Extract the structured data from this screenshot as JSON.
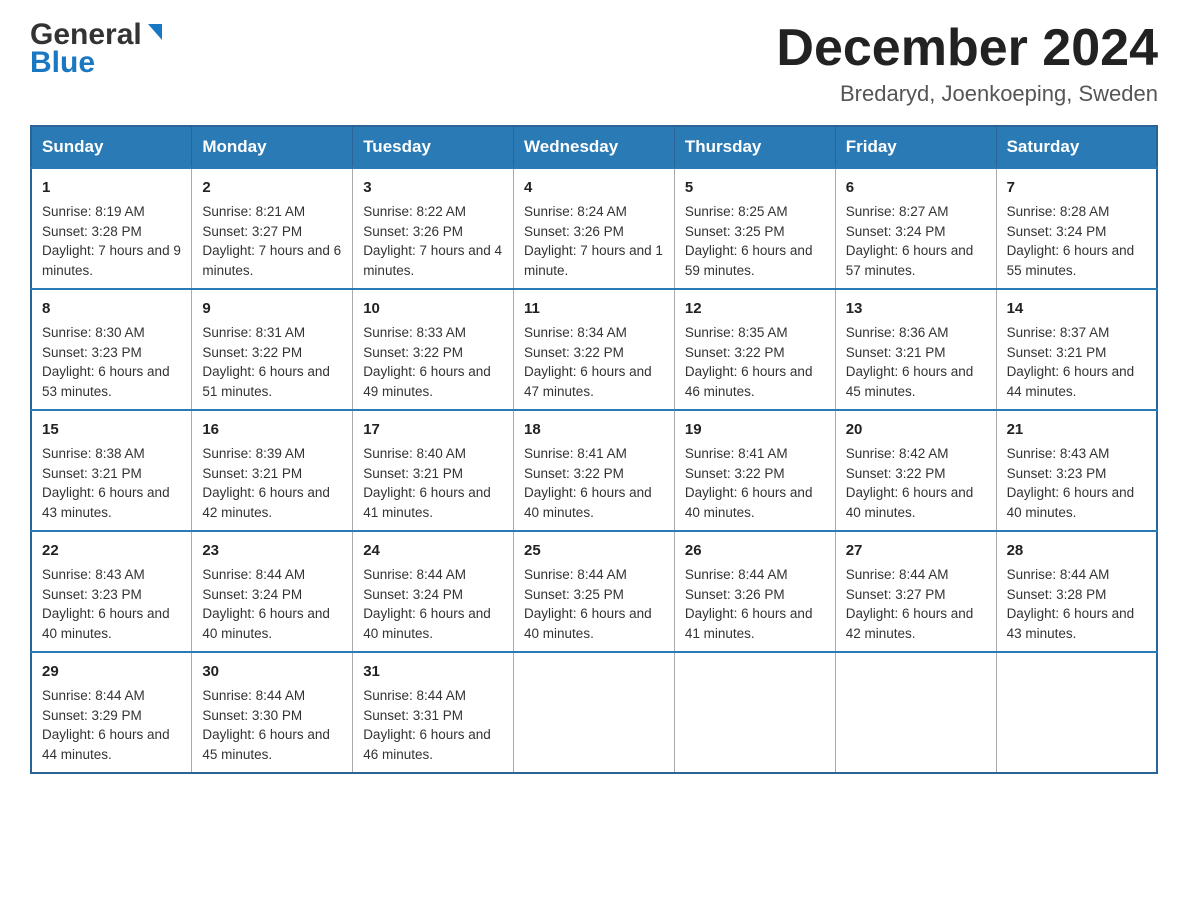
{
  "header": {
    "logo_general": "General",
    "logo_blue": "Blue",
    "month_title": "December 2024",
    "location": "Bredaryd, Joenkoeping, Sweden"
  },
  "columns": [
    "Sunday",
    "Monday",
    "Tuesday",
    "Wednesday",
    "Thursday",
    "Friday",
    "Saturday"
  ],
  "weeks": [
    [
      {
        "day": "1",
        "sunrise": "8:19 AM",
        "sunset": "3:28 PM",
        "daylight": "7 hours and 9 minutes."
      },
      {
        "day": "2",
        "sunrise": "8:21 AM",
        "sunset": "3:27 PM",
        "daylight": "7 hours and 6 minutes."
      },
      {
        "day": "3",
        "sunrise": "8:22 AM",
        "sunset": "3:26 PM",
        "daylight": "7 hours and 4 minutes."
      },
      {
        "day": "4",
        "sunrise": "8:24 AM",
        "sunset": "3:26 PM",
        "daylight": "7 hours and 1 minute."
      },
      {
        "day": "5",
        "sunrise": "8:25 AM",
        "sunset": "3:25 PM",
        "daylight": "6 hours and 59 minutes."
      },
      {
        "day": "6",
        "sunrise": "8:27 AM",
        "sunset": "3:24 PM",
        "daylight": "6 hours and 57 minutes."
      },
      {
        "day": "7",
        "sunrise": "8:28 AM",
        "sunset": "3:24 PM",
        "daylight": "6 hours and 55 minutes."
      }
    ],
    [
      {
        "day": "8",
        "sunrise": "8:30 AM",
        "sunset": "3:23 PM",
        "daylight": "6 hours and 53 minutes."
      },
      {
        "day": "9",
        "sunrise": "8:31 AM",
        "sunset": "3:22 PM",
        "daylight": "6 hours and 51 minutes."
      },
      {
        "day": "10",
        "sunrise": "8:33 AM",
        "sunset": "3:22 PM",
        "daylight": "6 hours and 49 minutes."
      },
      {
        "day": "11",
        "sunrise": "8:34 AM",
        "sunset": "3:22 PM",
        "daylight": "6 hours and 47 minutes."
      },
      {
        "day": "12",
        "sunrise": "8:35 AM",
        "sunset": "3:22 PM",
        "daylight": "6 hours and 46 minutes."
      },
      {
        "day": "13",
        "sunrise": "8:36 AM",
        "sunset": "3:21 PM",
        "daylight": "6 hours and 45 minutes."
      },
      {
        "day": "14",
        "sunrise": "8:37 AM",
        "sunset": "3:21 PM",
        "daylight": "6 hours and 44 minutes."
      }
    ],
    [
      {
        "day": "15",
        "sunrise": "8:38 AM",
        "sunset": "3:21 PM",
        "daylight": "6 hours and 43 minutes."
      },
      {
        "day": "16",
        "sunrise": "8:39 AM",
        "sunset": "3:21 PM",
        "daylight": "6 hours and 42 minutes."
      },
      {
        "day": "17",
        "sunrise": "8:40 AM",
        "sunset": "3:21 PM",
        "daylight": "6 hours and 41 minutes."
      },
      {
        "day": "18",
        "sunrise": "8:41 AM",
        "sunset": "3:22 PM",
        "daylight": "6 hours and 40 minutes."
      },
      {
        "day": "19",
        "sunrise": "8:41 AM",
        "sunset": "3:22 PM",
        "daylight": "6 hours and 40 minutes."
      },
      {
        "day": "20",
        "sunrise": "8:42 AM",
        "sunset": "3:22 PM",
        "daylight": "6 hours and 40 minutes."
      },
      {
        "day": "21",
        "sunrise": "8:43 AM",
        "sunset": "3:23 PM",
        "daylight": "6 hours and 40 minutes."
      }
    ],
    [
      {
        "day": "22",
        "sunrise": "8:43 AM",
        "sunset": "3:23 PM",
        "daylight": "6 hours and 40 minutes."
      },
      {
        "day": "23",
        "sunrise": "8:44 AM",
        "sunset": "3:24 PM",
        "daylight": "6 hours and 40 minutes."
      },
      {
        "day": "24",
        "sunrise": "8:44 AM",
        "sunset": "3:24 PM",
        "daylight": "6 hours and 40 minutes."
      },
      {
        "day": "25",
        "sunrise": "8:44 AM",
        "sunset": "3:25 PM",
        "daylight": "6 hours and 40 minutes."
      },
      {
        "day": "26",
        "sunrise": "8:44 AM",
        "sunset": "3:26 PM",
        "daylight": "6 hours and 41 minutes."
      },
      {
        "day": "27",
        "sunrise": "8:44 AM",
        "sunset": "3:27 PM",
        "daylight": "6 hours and 42 minutes."
      },
      {
        "day": "28",
        "sunrise": "8:44 AM",
        "sunset": "3:28 PM",
        "daylight": "6 hours and 43 minutes."
      }
    ],
    [
      {
        "day": "29",
        "sunrise": "8:44 AM",
        "sunset": "3:29 PM",
        "daylight": "6 hours and 44 minutes."
      },
      {
        "day": "30",
        "sunrise": "8:44 AM",
        "sunset": "3:30 PM",
        "daylight": "6 hours and 45 minutes."
      },
      {
        "day": "31",
        "sunrise": "8:44 AM",
        "sunset": "3:31 PM",
        "daylight": "6 hours and 46 minutes."
      },
      null,
      null,
      null,
      null
    ]
  ],
  "labels": {
    "sunrise": "Sunrise:",
    "sunset": "Sunset:",
    "daylight": "Daylight:"
  }
}
